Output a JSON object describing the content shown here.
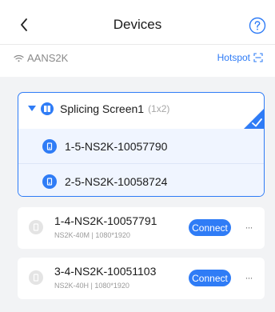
{
  "header": {
    "title": "Devices"
  },
  "network": {
    "ssid": "AANS2K",
    "hotspot_label": "Hotspot"
  },
  "group": {
    "name": "Splicing Screen1",
    "dimension": "(1x2)",
    "members": [
      {
        "label": "1-5-NS2K-10057790"
      },
      {
        "label": "2-5-NS2K-10058724"
      }
    ]
  },
  "devices": [
    {
      "name": "1-4-NS2K-10057791",
      "meta": "NS2K-40M  |  1080*1920",
      "action": "Connect",
      "more": "···"
    },
    {
      "name": "3-4-NS2K-10051103",
      "meta": "NS2K-40H  |  1080*1920",
      "action": "Connect",
      "more": "···"
    }
  ],
  "colors": {
    "accent": "#2f7cf6",
    "background": "#f2f3f5",
    "selected_row": "#f0f5ff"
  },
  "icons": [
    "back-arrow-icon",
    "help-icon",
    "wifi-icon",
    "scan-icon",
    "caret-down-icon",
    "group-icon",
    "device-icon",
    "check-icon",
    "more-icon"
  ]
}
